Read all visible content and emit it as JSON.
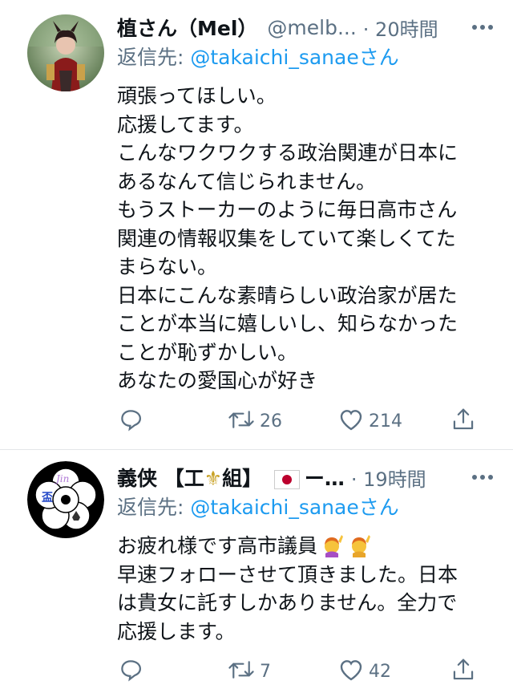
{
  "tweets": [
    {
      "name": "植さん（Mel）",
      "handle": "@melb...",
      "time": "· 20時間",
      "reply_prefix": "返信先: ",
      "reply_mention": "@takaichi_sanaeさん",
      "body": "頑張ってほしい。\n応援してます。\nこんなワクワクする政治関連が日本に\nあるなんて信じられません。\nもうストーカーのように毎日高市さん\n関連の情報収集をしていて楽しくてた\nまらない。\n日本にこんな素晴らしい政治家が居た\nことが本当に嬉しいし、知らなかった\nことが恥ずかしい。\nあなたの愛国心が好き",
      "retweets": "26",
      "likes": "214"
    },
    {
      "name_prefix": "義侠 【工",
      "name_suffix": "組】",
      "name_tail": "ー…",
      "time": "· 19時間",
      "reply_prefix": "返信先: ",
      "reply_mention": "@takaichi_sanaeさん",
      "body_line1": "お疲れ様です高市議員",
      "body_rest": "早速フォローさせて頂きました。日本\nは貴女に託すしかありません。全力で\n応援します。",
      "retweets": "7",
      "likes": "42",
      "avatar_text_1": "盃",
      "avatar_text_2": "Jin"
    }
  ],
  "icons": {
    "reply": "reply-icon",
    "retweet": "retweet-icon",
    "like": "heart-icon",
    "share": "share-icon",
    "more": "more-icon"
  },
  "colors": {
    "text": "#0f1419",
    "secondary": "#5b7083",
    "link": "#1d9bf0",
    "divider": "#e3e6e8"
  }
}
